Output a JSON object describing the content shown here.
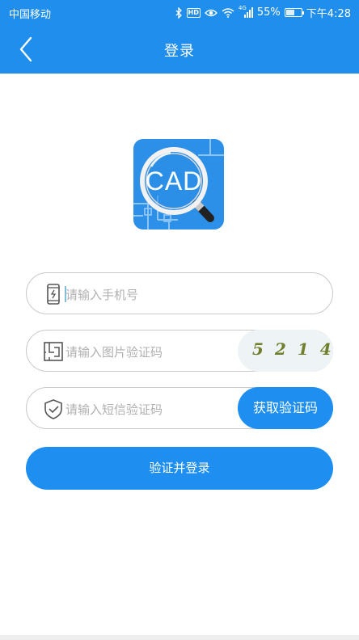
{
  "status_bar": {
    "carrier": "中国移动",
    "hd_badge": "HD",
    "network": "4G",
    "battery_text": "55%",
    "battery_level": 0.55,
    "time": "下午4:28"
  },
  "nav": {
    "title": "登录",
    "back_icon": "chevron-left-icon"
  },
  "logo": {
    "text": "CAD"
  },
  "form": {
    "phone_placeholder": "请输入手机号",
    "captcha_placeholder": "请输入图片验证码",
    "captcha_digits": "5214",
    "sms_placeholder": "请输入短信验证码",
    "sms_button_label": "获取验证码",
    "login_button_label": "验证并登录"
  },
  "colors": {
    "primary": "#1f8eed",
    "captcha_text": "#6f7f2c",
    "placeholder": "#b0b0b0"
  }
}
